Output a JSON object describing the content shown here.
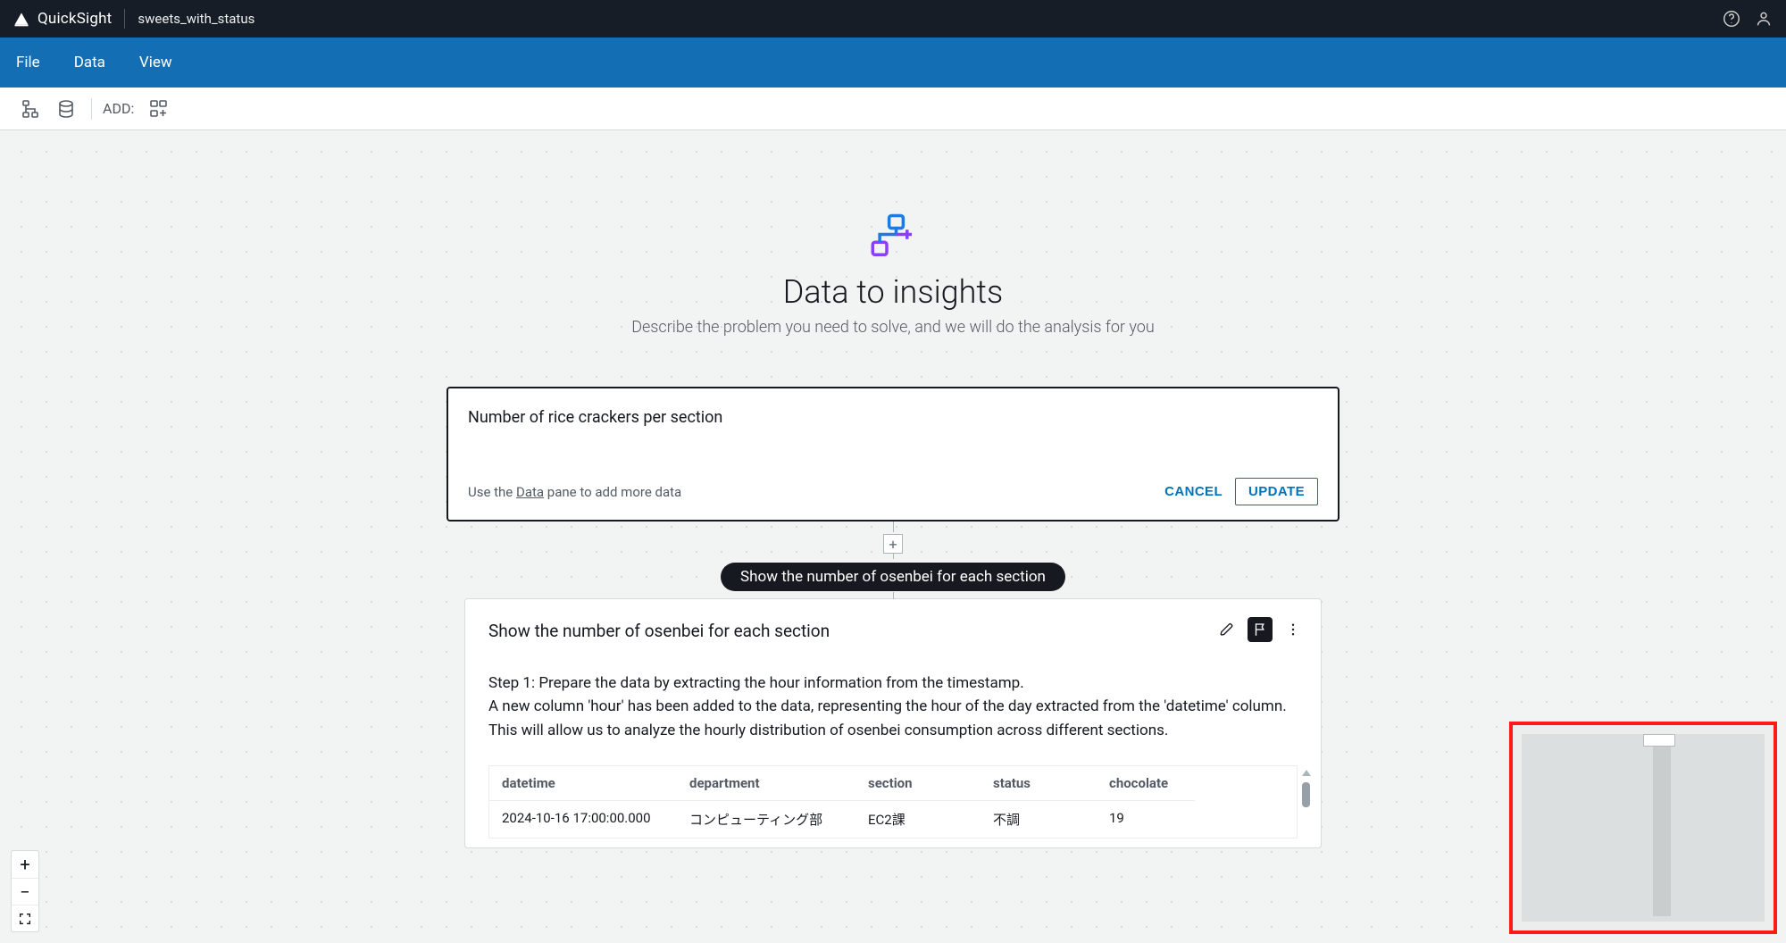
{
  "app": {
    "name": "QuickSight",
    "doc_title": "sweets_with_status"
  },
  "menubar": {
    "file": "File",
    "data": "Data",
    "view": "View"
  },
  "toolbar": {
    "add_label": "ADD:"
  },
  "hero": {
    "title": "Data to insights",
    "subtitle": "Describe the problem you need to solve, and we will do the analysis for you"
  },
  "prompt": {
    "value": "Number of rice crackers per section",
    "hint_prefix": "Use the ",
    "hint_link": "Data",
    "hint_suffix": " pane to add more data",
    "cancel": "CANCEL",
    "update": "UPDATE"
  },
  "question_pill": "Show the number of osenbei for each section",
  "card": {
    "title": "Show the number of osenbei for each section",
    "body_line1": "Step 1: Prepare the data by extracting the hour information from the timestamp.",
    "body_rest": "A new column 'hour' has been added to the data, representing the hour of the day extracted from the 'datetime' column. This will allow us to analyze the hourly distribution of osenbei consumption across different sections.",
    "table": {
      "headers": [
        "datetime",
        "department",
        "section",
        "status",
        "chocolate"
      ],
      "row0": [
        "2024-10-16 17:00:00.000",
        "コンピューティング部",
        "EC2課",
        "不調",
        "19"
      ]
    }
  }
}
